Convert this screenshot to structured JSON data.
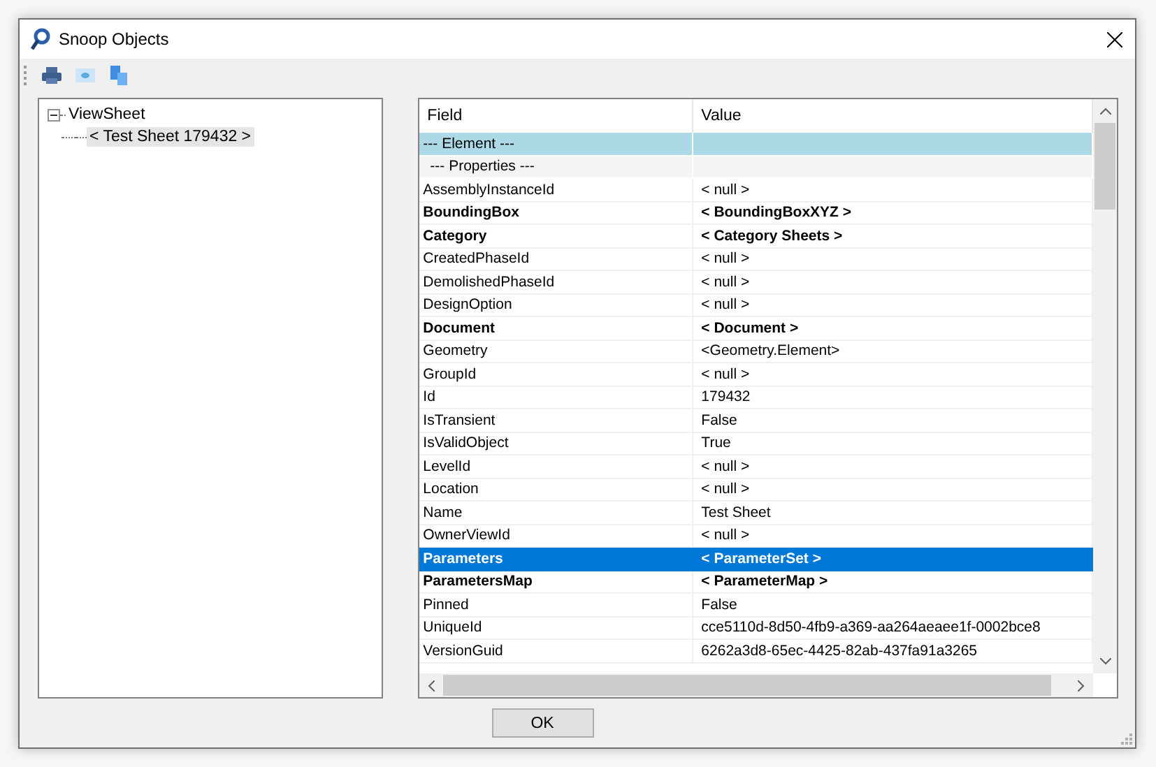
{
  "window": {
    "title": "Snoop Objects"
  },
  "toolbar": [
    {
      "kind": "print"
    },
    {
      "kind": "view"
    },
    {
      "kind": "copy"
    }
  ],
  "tree": [
    {
      "label": "ViewSheet",
      "expanded": true,
      "selected": false,
      "children": [
        {
          "label": "< Test Sheet  179432 >",
          "selected": true
        }
      ]
    }
  ],
  "table": {
    "columns": [
      "Field",
      "Value"
    ],
    "rows": [
      {
        "kind": "section",
        "field": "--- Element ---",
        "value": "",
        "bold": false,
        "selected": false
      },
      {
        "kind": "subsection",
        "field": "--- Properties ---",
        "value": "",
        "bold": false,
        "selected": false
      },
      {
        "kind": "prop",
        "field": "AssemblyInstanceId",
        "value": "< null >",
        "bold": false,
        "selected": false
      },
      {
        "kind": "prop",
        "field": "BoundingBox",
        "value": "< BoundingBoxXYZ >",
        "bold": true,
        "selected": false
      },
      {
        "kind": "prop",
        "field": "Category",
        "value": "< Category   Sheets >",
        "bold": true,
        "selected": false
      },
      {
        "kind": "prop",
        "field": "CreatedPhaseId",
        "value": "< null >",
        "bold": false,
        "selected": false
      },
      {
        "kind": "prop",
        "field": "DemolishedPhaseId",
        "value": "< null >",
        "bold": false,
        "selected": false
      },
      {
        "kind": "prop",
        "field": "DesignOption",
        "value": "< null >",
        "bold": false,
        "selected": false
      },
      {
        "kind": "prop",
        "field": "Document",
        "value": "< Document >",
        "bold": true,
        "selected": false
      },
      {
        "kind": "prop",
        "field": "Geometry",
        "value": "<Geometry.Element>",
        "bold": false,
        "selected": false
      },
      {
        "kind": "prop",
        "field": "GroupId",
        "value": "< null >",
        "bold": false,
        "selected": false
      },
      {
        "kind": "prop",
        "field": "Id",
        "value": "179432",
        "bold": false,
        "selected": false
      },
      {
        "kind": "prop",
        "field": "IsTransient",
        "value": "False",
        "bold": false,
        "selected": false
      },
      {
        "kind": "prop",
        "field": "IsValidObject",
        "value": "True",
        "bold": false,
        "selected": false
      },
      {
        "kind": "prop",
        "field": "LevelId",
        "value": "< null >",
        "bold": false,
        "selected": false
      },
      {
        "kind": "prop",
        "field": "Location",
        "value": "< null >",
        "bold": false,
        "selected": false
      },
      {
        "kind": "prop",
        "field": "Name",
        "value": "Test Sheet",
        "bold": false,
        "selected": false
      },
      {
        "kind": "prop",
        "field": "OwnerViewId",
        "value": "< null >",
        "bold": false,
        "selected": false
      },
      {
        "kind": "prop",
        "field": "Parameters",
        "value": "< ParameterSet >",
        "bold": true,
        "selected": true
      },
      {
        "kind": "prop",
        "field": "ParametersMap",
        "value": "< ParameterMap >",
        "bold": true,
        "selected": false
      },
      {
        "kind": "prop",
        "field": "Pinned",
        "value": "False",
        "bold": false,
        "selected": false
      },
      {
        "kind": "prop",
        "field": "UniqueId",
        "value": "cce5110d-8d50-4fb9-a369-aa264aeaee1f-0002bce8",
        "bold": false,
        "selected": false
      },
      {
        "kind": "prop",
        "field": "VersionGuid",
        "value": "6262a3d8-65ec-4425-82ab-437fa91a3265",
        "bold": false,
        "selected": false
      }
    ]
  },
  "buttons": [
    "OK"
  ]
}
